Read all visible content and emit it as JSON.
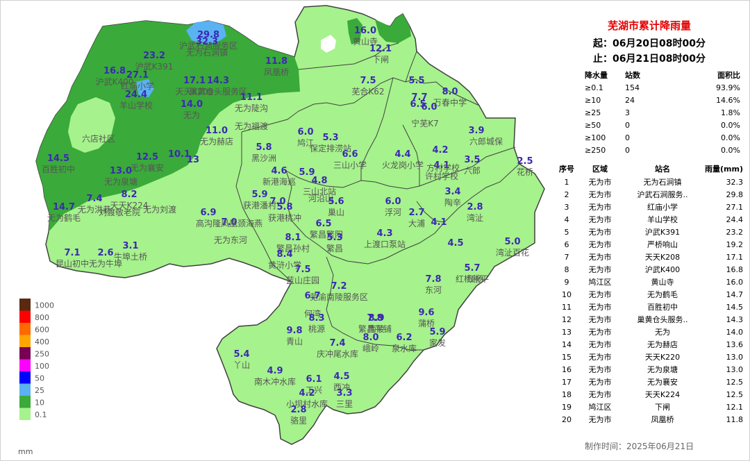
{
  "title": "芜湖市累计降雨量",
  "start": "起：06月20日08时00分",
  "end": "止：06月21日08时00分",
  "stats": {
    "headers": [
      "降水量",
      "站数",
      "面积比"
    ],
    "rows": [
      [
        "≥0.1",
        "154",
        "93.9%"
      ],
      [
        "≥10",
        "24",
        "14.6%"
      ],
      [
        "≥25",
        "3",
        "1.8%"
      ],
      [
        "≥50",
        "0",
        "0.0%"
      ],
      [
        "≥100",
        "0",
        "0.0%"
      ],
      [
        "≥250",
        "0",
        "0.0%"
      ]
    ]
  },
  "ranking": {
    "headers": [
      "序号",
      "区域",
      "站名",
      "雨量(mm)"
    ],
    "rows": [
      [
        "1",
        "无为市",
        "无为石涧镇",
        "32.3"
      ],
      [
        "2",
        "无为市",
        "沪武石涧服务..",
        "29.8"
      ],
      [
        "3",
        "无为市",
        "红庙小学",
        "27.1"
      ],
      [
        "4",
        "无为市",
        "羊山学校",
        "24.4"
      ],
      [
        "5",
        "无为市",
        "沪武K391",
        "23.2"
      ],
      [
        "6",
        "无为市",
        "严桥响山",
        "19.2"
      ],
      [
        "7",
        "无为市",
        "天天K208",
        "17.1"
      ],
      [
        "8",
        "无为市",
        "沪武K400",
        "16.8"
      ],
      [
        "9",
        "鸠江区",
        "黄山寺",
        "16.0"
      ],
      [
        "10",
        "无为市",
        "无为鹤毛",
        "14.7"
      ],
      [
        "11",
        "无为市",
        "百胜初中",
        "14.5"
      ],
      [
        "12",
        "无为市",
        "巢黄仓头服务..",
        "14.3"
      ],
      [
        "13",
        "无为市",
        "无为",
        "14.0"
      ],
      [
        "14",
        "无为市",
        "无为赫店",
        "13.6"
      ],
      [
        "15",
        "无为市",
        "天天K220",
        "13.0"
      ],
      [
        "16",
        "无为市",
        "无为泉塘",
        "13.0"
      ],
      [
        "17",
        "无为市",
        "无为襄安",
        "12.5"
      ],
      [
        "18",
        "无为市",
        "天天K224",
        "12.5"
      ],
      [
        "19",
        "鸠江区",
        "下闸",
        "12.1"
      ],
      [
        "20",
        "无为市",
        "凤凰桥",
        "11.8"
      ]
    ]
  },
  "footer": "制作时间：2025年06月21日",
  "legend": {
    "unit": "mm",
    "items": [
      {
        "label": "1000",
        "color": "#5a2a10"
      },
      {
        "label": "800",
        "color": "#ff0000"
      },
      {
        "label": "600",
        "color": "#ff6a00"
      },
      {
        "label": "400",
        "color": "#ffa500"
      },
      {
        "label": "250",
        "color": "#7a0055"
      },
      {
        "label": "100",
        "color": "#ff00ff"
      },
      {
        "label": "50",
        "color": "#0000ff"
      },
      {
        "label": "25",
        "color": "#5ab2f2"
      },
      {
        "label": "10",
        "color": "#3aaa3a"
      },
      {
        "label": "0.1",
        "color": "#a6f28c"
      }
    ]
  },
  "map_colors": {
    "light": "#a6f28c",
    "mid": "#3aaa3a",
    "blue": "#5ab2f2",
    "border": "#404040"
  },
  "stations": [
    {
      "name": "沪武石涧服务区",
      "value": "29.8"
    },
    {
      "name": "无为石涧镇",
      "value": "32.3"
    },
    {
      "name": "沪武K391",
      "value": "23.2"
    },
    {
      "name": "沪武K400",
      "value": "16.8"
    },
    {
      "name": "红庙小学",
      "value": "27.1"
    },
    {
      "name": "羊山学校",
      "value": "24.4"
    },
    {
      "name": "天天K208",
      "value": "17.1"
    },
    {
      "name": "巢黄仓头服务区",
      "value": "14.3"
    },
    {
      "name": "无为",
      "value": "14.0"
    },
    {
      "name": "无为陡沟",
      "value": "11.1"
    },
    {
      "name": "凤凰桥",
      "value": "11.8"
    },
    {
      "name": "黄山寺",
      "value": "16.0"
    },
    {
      "name": "下闸",
      "value": "12.1"
    },
    {
      "name": "芜合K62",
      "value": "7.5"
    },
    {
      "name": "",
      "value": "5.5"
    },
    {
      "name": "",
      "value": "7.7"
    },
    {
      "name": "",
      "value": "6.5"
    },
    {
      "name": "",
      "value": "6.0"
    },
    {
      "name": "万春中学",
      "value": "8.0"
    },
    {
      "name": "宁芜K7",
      "value": ""
    },
    {
      "name": "六店社区",
      "value": ""
    },
    {
      "name": "无为福渡",
      "value": ""
    },
    {
      "name": "无为赫店",
      "value": "11.0"
    },
    {
      "name": "百胜初中",
      "value": "14.5"
    },
    {
      "name": "无为襄安",
      "value": "12.5"
    },
    {
      "name": "",
      "value": "10.1"
    },
    {
      "name": "",
      "value": "13"
    },
    {
      "name": "无为泉塘",
      "value": "13.0"
    },
    {
      "name": "天天K224",
      "value": "8.2"
    },
    {
      "name": "无为洪巷",
      "value": "7.4"
    },
    {
      "name": "无为鹤毛",
      "value": "14.7"
    },
    {
      "name": "刘渡敬老院",
      "value": ""
    },
    {
      "name": "无为刘渡",
      "value": ""
    },
    {
      "name": "高沟隆",
      "value": "6.9"
    },
    {
      "name": "",
      "value": "7.0"
    },
    {
      "name": "凤凰颈海燕",
      "value": ""
    },
    {
      "name": "无为东河",
      "value": ""
    },
    {
      "name": "牛埠土桥",
      "value": "3.1"
    },
    {
      "name": "昆山初中",
      "value": "7.1"
    },
    {
      "name": "无为牛埠",
      "value": "2.6"
    },
    {
      "name": "黑沙洲",
      "value": "5.8"
    },
    {
      "name": "鸠江",
      "value": "6.0"
    },
    {
      "name": "保定排涝站",
      "value": "5.3"
    },
    {
      "name": "三山小学",
      "value": "6.6"
    },
    {
      "name": "新港海巡",
      "value": "4.6"
    },
    {
      "name": "",
      "value": "5.9"
    },
    {
      "name": "三山北站",
      "value": "4.8"
    },
    {
      "name": "河沿山",
      "value": ""
    },
    {
      "name": "获港潘村",
      "value": "5.9"
    },
    {
      "name": "获港桃冲",
      "value": "5.8"
    },
    {
      "name": "",
      "value": "7.0"
    },
    {
      "name": "巢山",
      "value": "5.6"
    },
    {
      "name": "火龙岗小学",
      "value": "4.4"
    },
    {
      "name": "",
      "value": "6.5"
    },
    {
      "name": "繁昌繁阳",
      "value": ""
    },
    {
      "name": "繁昌",
      "value": "5.3"
    },
    {
      "name": "繁昌孙村",
      "value": "8.1"
    },
    {
      "name": "黄浒小学",
      "value": "8.4"
    },
    {
      "name": "蓝山庄园",
      "value": "7.5"
    },
    {
      "name": "",
      "value": "6.7"
    },
    {
      "name": "芜渝南陵服务区",
      "value": "7.2"
    },
    {
      "name": "何湾",
      "value": ""
    },
    {
      "name": "桃源",
      "value": "8.3"
    },
    {
      "name": "青山",
      "value": "9.8"
    },
    {
      "name": "繁昌平铺",
      "value": "7.8"
    },
    {
      "name": "上渡口泵站",
      "value": "4.3"
    },
    {
      "name": "浮河",
      "value": "6.0"
    },
    {
      "name": "大浦",
      "value": "2.7"
    },
    {
      "name": "",
      "value": "4.1"
    },
    {
      "name": "许村学校",
      "value": "4.1"
    },
    {
      "name": "六郎",
      "value": "3.5"
    },
    {
      "name": "",
      "value": "4.2"
    },
    {
      "name": "方村学校",
      "value": ""
    },
    {
      "name": "",
      "value": "3.9"
    },
    {
      "name": "六郎城保",
      "value": ""
    },
    {
      "name": "花桥",
      "value": "2.5"
    },
    {
      "name": "陶辛",
      "value": "3.4"
    },
    {
      "name": "湾沚",
      "value": "2.8"
    },
    {
      "name": "湾沚百花",
      "value": "5.0"
    },
    {
      "name": "",
      "value": "4.5"
    },
    {
      "name": "红杨",
      "value": ""
    },
    {
      "name": "红杨秋平",
      "value": "5.7"
    },
    {
      "name": "东河",
      "value": "7.8"
    },
    {
      "name": "蒲桥",
      "value": "9.6"
    },
    {
      "name": "南陵",
      "value": "8.9"
    },
    {
      "name": "峨岭",
      "value": "8.0"
    },
    {
      "name": "庆冲尾水库",
      "value": "7.4"
    },
    {
      "name": "泉水库",
      "value": "6.2"
    },
    {
      "name": "家发",
      "value": "5.9"
    },
    {
      "name": "丫山",
      "value": "5.4"
    },
    {
      "name": "南木冲水库",
      "value": "4.9"
    },
    {
      "name": "西冲",
      "value": "4.5"
    },
    {
      "name": "工兴",
      "value": "6.1"
    },
    {
      "name": "小坝村水库",
      "value": "4.2"
    },
    {
      "name": "三里",
      "value": "3.3"
    },
    {
      "name": "骆里",
      "value": "2.8"
    }
  ]
}
